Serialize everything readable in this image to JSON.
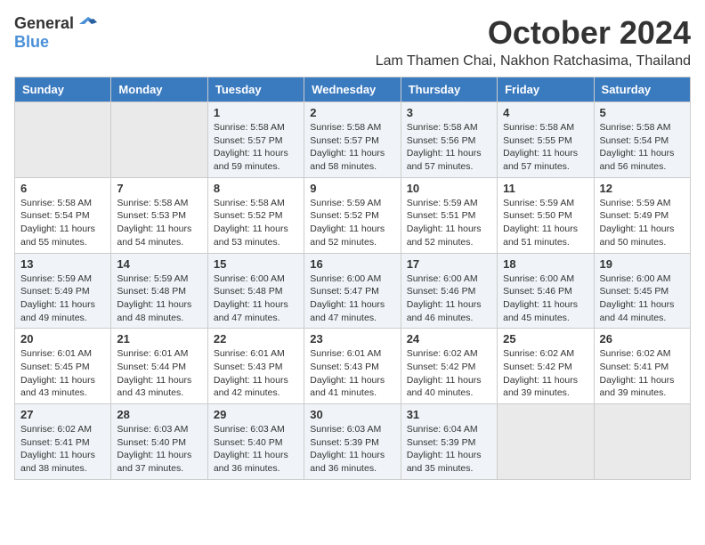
{
  "logo": {
    "general": "General",
    "blue": "Blue"
  },
  "title": "October 2024",
  "location": "Lam Thamen Chai, Nakhon Ratchasima, Thailand",
  "days_of_week": [
    "Sunday",
    "Monday",
    "Tuesday",
    "Wednesday",
    "Thursday",
    "Friday",
    "Saturday"
  ],
  "weeks": [
    [
      {
        "day": "",
        "info": ""
      },
      {
        "day": "",
        "info": ""
      },
      {
        "day": "1",
        "info": "Sunrise: 5:58 AM\nSunset: 5:57 PM\nDaylight: 11 hours and 59 minutes."
      },
      {
        "day": "2",
        "info": "Sunrise: 5:58 AM\nSunset: 5:57 PM\nDaylight: 11 hours and 58 minutes."
      },
      {
        "day": "3",
        "info": "Sunrise: 5:58 AM\nSunset: 5:56 PM\nDaylight: 11 hours and 57 minutes."
      },
      {
        "day": "4",
        "info": "Sunrise: 5:58 AM\nSunset: 5:55 PM\nDaylight: 11 hours and 57 minutes."
      },
      {
        "day": "5",
        "info": "Sunrise: 5:58 AM\nSunset: 5:54 PM\nDaylight: 11 hours and 56 minutes."
      }
    ],
    [
      {
        "day": "6",
        "info": "Sunrise: 5:58 AM\nSunset: 5:54 PM\nDaylight: 11 hours and 55 minutes."
      },
      {
        "day": "7",
        "info": "Sunrise: 5:58 AM\nSunset: 5:53 PM\nDaylight: 11 hours and 54 minutes."
      },
      {
        "day": "8",
        "info": "Sunrise: 5:58 AM\nSunset: 5:52 PM\nDaylight: 11 hours and 53 minutes."
      },
      {
        "day": "9",
        "info": "Sunrise: 5:59 AM\nSunset: 5:52 PM\nDaylight: 11 hours and 52 minutes."
      },
      {
        "day": "10",
        "info": "Sunrise: 5:59 AM\nSunset: 5:51 PM\nDaylight: 11 hours and 52 minutes."
      },
      {
        "day": "11",
        "info": "Sunrise: 5:59 AM\nSunset: 5:50 PM\nDaylight: 11 hours and 51 minutes."
      },
      {
        "day": "12",
        "info": "Sunrise: 5:59 AM\nSunset: 5:49 PM\nDaylight: 11 hours and 50 minutes."
      }
    ],
    [
      {
        "day": "13",
        "info": "Sunrise: 5:59 AM\nSunset: 5:49 PM\nDaylight: 11 hours and 49 minutes."
      },
      {
        "day": "14",
        "info": "Sunrise: 5:59 AM\nSunset: 5:48 PM\nDaylight: 11 hours and 48 minutes."
      },
      {
        "day": "15",
        "info": "Sunrise: 6:00 AM\nSunset: 5:48 PM\nDaylight: 11 hours and 47 minutes."
      },
      {
        "day": "16",
        "info": "Sunrise: 6:00 AM\nSunset: 5:47 PM\nDaylight: 11 hours and 47 minutes."
      },
      {
        "day": "17",
        "info": "Sunrise: 6:00 AM\nSunset: 5:46 PM\nDaylight: 11 hours and 46 minutes."
      },
      {
        "day": "18",
        "info": "Sunrise: 6:00 AM\nSunset: 5:46 PM\nDaylight: 11 hours and 45 minutes."
      },
      {
        "day": "19",
        "info": "Sunrise: 6:00 AM\nSunset: 5:45 PM\nDaylight: 11 hours and 44 minutes."
      }
    ],
    [
      {
        "day": "20",
        "info": "Sunrise: 6:01 AM\nSunset: 5:45 PM\nDaylight: 11 hours and 43 minutes."
      },
      {
        "day": "21",
        "info": "Sunrise: 6:01 AM\nSunset: 5:44 PM\nDaylight: 11 hours and 43 minutes."
      },
      {
        "day": "22",
        "info": "Sunrise: 6:01 AM\nSunset: 5:43 PM\nDaylight: 11 hours and 42 minutes."
      },
      {
        "day": "23",
        "info": "Sunrise: 6:01 AM\nSunset: 5:43 PM\nDaylight: 11 hours and 41 minutes."
      },
      {
        "day": "24",
        "info": "Sunrise: 6:02 AM\nSunset: 5:42 PM\nDaylight: 11 hours and 40 minutes."
      },
      {
        "day": "25",
        "info": "Sunrise: 6:02 AM\nSunset: 5:42 PM\nDaylight: 11 hours and 39 minutes."
      },
      {
        "day": "26",
        "info": "Sunrise: 6:02 AM\nSunset: 5:41 PM\nDaylight: 11 hours and 39 minutes."
      }
    ],
    [
      {
        "day": "27",
        "info": "Sunrise: 6:02 AM\nSunset: 5:41 PM\nDaylight: 11 hours and 38 minutes."
      },
      {
        "day": "28",
        "info": "Sunrise: 6:03 AM\nSunset: 5:40 PM\nDaylight: 11 hours and 37 minutes."
      },
      {
        "day": "29",
        "info": "Sunrise: 6:03 AM\nSunset: 5:40 PM\nDaylight: 11 hours and 36 minutes."
      },
      {
        "day": "30",
        "info": "Sunrise: 6:03 AM\nSunset: 5:39 PM\nDaylight: 11 hours and 36 minutes."
      },
      {
        "day": "31",
        "info": "Sunrise: 6:04 AM\nSunset: 5:39 PM\nDaylight: 11 hours and 35 minutes."
      },
      {
        "day": "",
        "info": ""
      },
      {
        "day": "",
        "info": ""
      }
    ]
  ]
}
